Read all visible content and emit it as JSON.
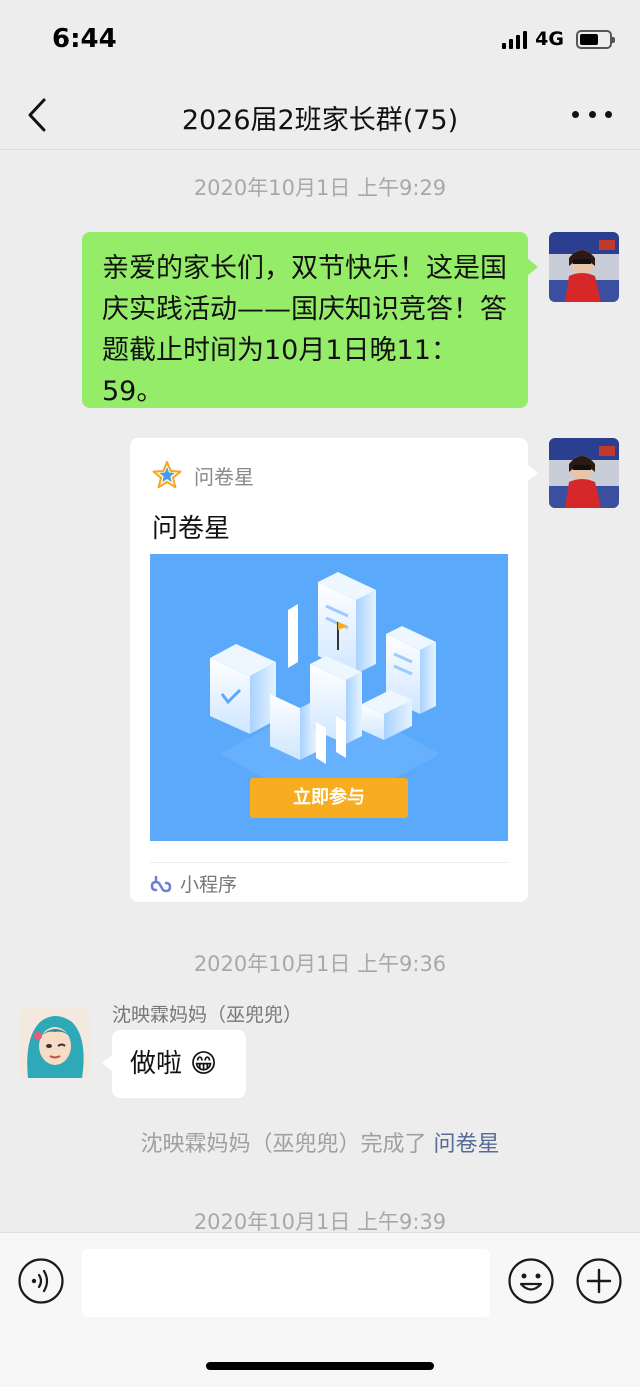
{
  "status_bar": {
    "time": "6:44",
    "network": "4G"
  },
  "header": {
    "title": "2026届2班家长群(75)"
  },
  "messages": {
    "ts1": "2020年10月1日 上午9:29",
    "msg1_text": "亲爱的家长们，双节快乐！这是国庆实践活动——国庆知识竞答！答题截止时间为10月1日晚11：59。",
    "card": {
      "app_name": "问卷星",
      "title": "问卷星",
      "button_label": "立即参与",
      "footer_label": "小程序"
    },
    "ts2": "2020年10月1日 上午9:36",
    "sender_name": "沈映霖妈妈（巫兜兜）",
    "msg2_text": "做啦",
    "msg2_emoji": "😁",
    "system_text": "沈映霖妈妈（巫兜兜）完成了",
    "system_link": "问卷星",
    "ts3": "2020年10月1日 上午9:39"
  },
  "colors": {
    "background": "#ededed",
    "outgoing_bubble": "#95ec69",
    "incoming_bubble": "#ffffff",
    "card_image_bg": "#5aa9fb",
    "card_button": "#f7ad1f",
    "link": "#576b95"
  }
}
